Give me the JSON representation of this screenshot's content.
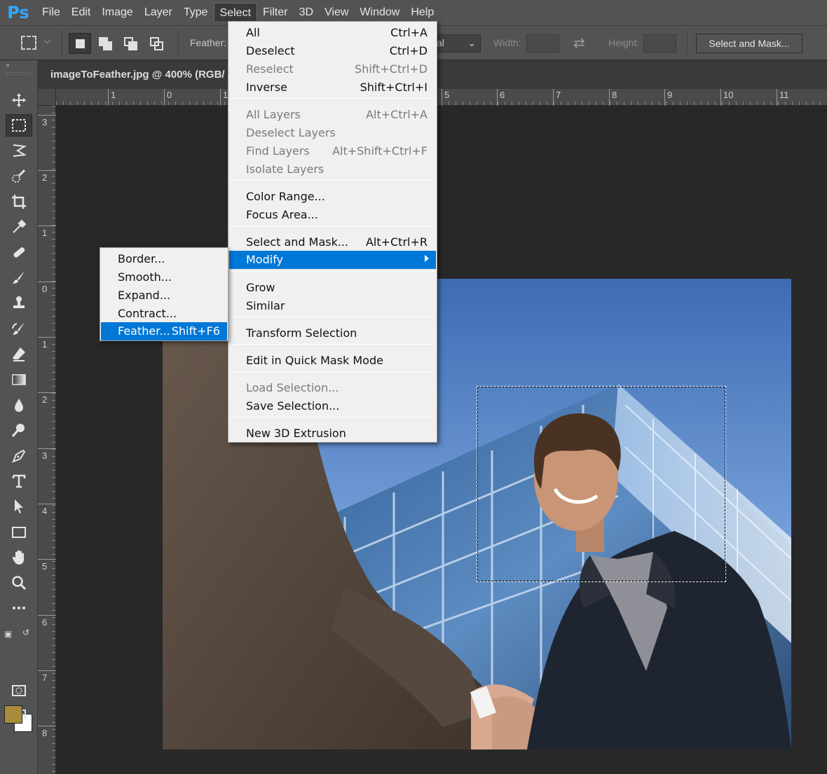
{
  "app": {
    "logo": "Ps",
    "menus": [
      "File",
      "Edit",
      "Image",
      "Layer",
      "Type",
      "Select",
      "Filter",
      "3D",
      "View",
      "Window",
      "Help"
    ],
    "active_menu": "Select"
  },
  "options_bar": {
    "feather_label": "Feather:",
    "style_value": "al",
    "width_label": "Width:",
    "height_label": "Height:",
    "select_and_mask_label": "Select and Mask..."
  },
  "document": {
    "tab_title": "imageToFeather.jpg @ 400% (RGB/"
  },
  "rulers": {
    "horizontal": [
      "1",
      "0",
      "1",
      "5",
      "6",
      "7",
      "8",
      "9",
      "10",
      "11"
    ],
    "vertical": [
      "3",
      "2",
      "1",
      "0",
      "1",
      "2",
      "3",
      "4",
      "5",
      "6",
      "7",
      "8"
    ]
  },
  "select_menu": {
    "items": [
      {
        "label": "All",
        "shortcut": "Ctrl+A",
        "disabled": false
      },
      {
        "label": "Deselect",
        "shortcut": "Ctrl+D",
        "disabled": false
      },
      {
        "label": "Reselect",
        "shortcut": "Shift+Ctrl+D",
        "disabled": true
      },
      {
        "label": "Inverse",
        "shortcut": "Shift+Ctrl+I",
        "disabled": false
      },
      {
        "label": "All Layers",
        "shortcut": "Alt+Ctrl+A",
        "disabled": true
      },
      {
        "label": "Deselect Layers",
        "shortcut": "",
        "disabled": true
      },
      {
        "label": "Find Layers",
        "shortcut": "Alt+Shift+Ctrl+F",
        "disabled": true
      },
      {
        "label": "Isolate Layers",
        "shortcut": "",
        "disabled": true
      },
      {
        "label": "Color Range...",
        "shortcut": "",
        "disabled": false
      },
      {
        "label": "Focus Area...",
        "shortcut": "",
        "disabled": false
      },
      {
        "label": "Select and Mask...",
        "shortcut": "Alt+Ctrl+R",
        "disabled": false
      },
      {
        "label": "Modify",
        "shortcut": "",
        "disabled": false,
        "highlighted": true,
        "submenu": true
      },
      {
        "label": "Grow",
        "shortcut": "",
        "disabled": false
      },
      {
        "label": "Similar",
        "shortcut": "",
        "disabled": false
      },
      {
        "label": "Transform Selection",
        "shortcut": "",
        "disabled": false
      },
      {
        "label": "Edit in Quick Mask Mode",
        "shortcut": "",
        "disabled": false
      },
      {
        "label": "Load Selection...",
        "shortcut": "",
        "disabled": true
      },
      {
        "label": "Save Selection...",
        "shortcut": "",
        "disabled": false
      },
      {
        "label": "New 3D Extrusion",
        "shortcut": "",
        "disabled": false
      }
    ]
  },
  "modify_submenu": {
    "items": [
      {
        "label": "Border...",
        "shortcut": ""
      },
      {
        "label": "Smooth...",
        "shortcut": ""
      },
      {
        "label": "Expand...",
        "shortcut": ""
      },
      {
        "label": "Contract...",
        "shortcut": ""
      },
      {
        "label": "Feather...",
        "shortcut": "Shift+F6",
        "highlighted": true
      }
    ]
  },
  "colors": {
    "foreground": "#a88c3c",
    "background": "#ffffff",
    "highlight": "#0078d7"
  },
  "tools": [
    "move-tool",
    "rectangular-marquee-tool",
    "lasso-tool",
    "quick-selection-tool",
    "crop-tool",
    "eyedropper-tool",
    "healing-brush-tool",
    "brush-tool",
    "clone-stamp-tool",
    "history-brush-tool",
    "eraser-tool",
    "gradient-tool",
    "blur-tool",
    "dodge-tool",
    "pen-tool",
    "type-tool",
    "path-selection-tool",
    "rectangle-tool",
    "hand-tool",
    "zoom-tool",
    "more-tools"
  ]
}
